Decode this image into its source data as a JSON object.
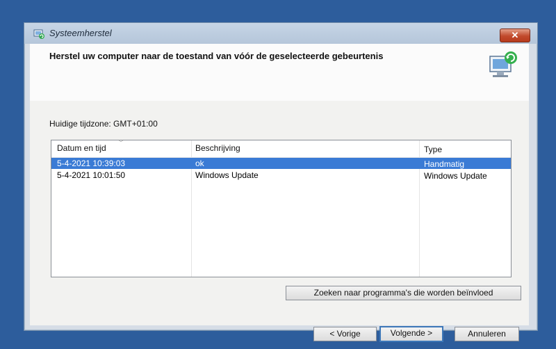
{
  "window": {
    "title": "Systeemherstel",
    "close_label": "✕"
  },
  "header": {
    "text": "Herstel uw computer naar de toestand van vóór de geselecteerde gebeurtenis"
  },
  "timezone_label": "Huidige tijdzone: GMT+01:00",
  "table": {
    "columns": [
      "Datum en tijd",
      "Beschrijving",
      "Type"
    ],
    "rows": [
      {
        "date": "5-4-2021 10:39:03",
        "description": "ok",
        "type": "Handmatig",
        "selected": true
      },
      {
        "date": "5-4-2021 10:01:50",
        "description": "Windows Update",
        "type": "Windows Update",
        "selected": false
      }
    ]
  },
  "buttons": {
    "scan": "Zoeken naar programma's die worden beïnvloed",
    "back": "< Vorige",
    "next": "Volgende >",
    "cancel": "Annuleren"
  },
  "colors": {
    "desktop": "#2d5d9c",
    "selection": "#3a7bd5",
    "close_button": "#c14a2c"
  },
  "icons": [
    "system-restore-icon",
    "restore-computer-icon",
    "close-icon"
  ]
}
